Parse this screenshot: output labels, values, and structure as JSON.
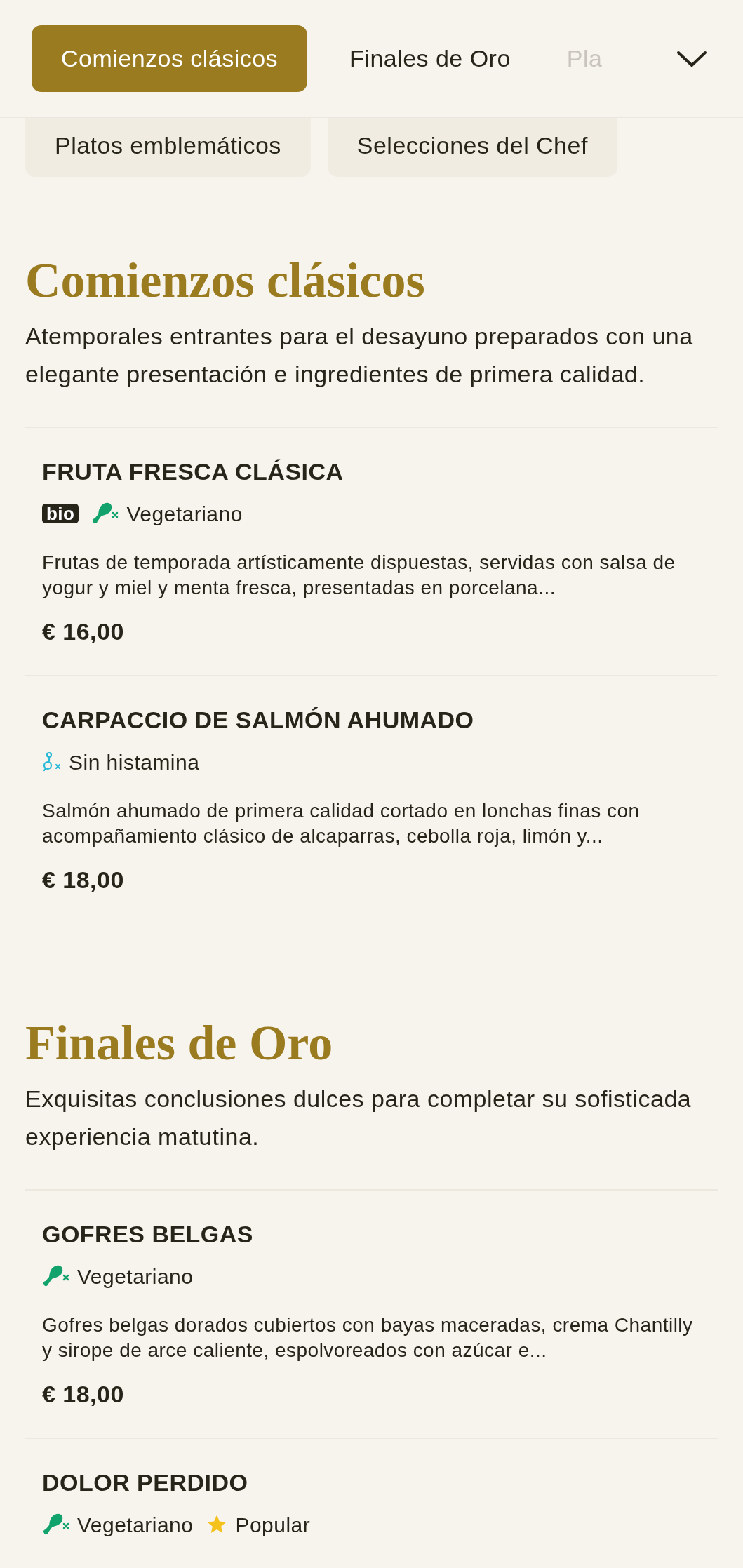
{
  "tabs": [
    {
      "label": "Comienzos clásicos",
      "selected": true
    },
    {
      "label": "Finales de Oro",
      "selected": false
    },
    {
      "label": "Pla",
      "selected": false,
      "cut": true
    }
  ],
  "category_chips": [
    "Platos emblemáticos",
    "Selecciones del Chef"
  ],
  "sections": [
    {
      "title": "Comienzos clásicos",
      "description": "Atemporales entrantes para el desayuno preparados con una elegante presentación e ingredientes de primera calidad.",
      "items": [
        {
          "name": "FRUTA FRESCA CLÁSICA",
          "tags": [
            {
              "kind": "bio",
              "label": "bio"
            },
            {
              "kind": "vegetarian",
              "label": "Vegetariano"
            }
          ],
          "description": "Frutas de temporada artísticamente dispuestas, servidas con salsa de yogur y miel y menta fresca, presentadas en porcelana...",
          "price": "€ 16,00"
        },
        {
          "name": "CARPACCIO DE SALMÓN AHUMADO",
          "tags": [
            {
              "kind": "histamine_free",
              "label": "Sin histamina"
            }
          ],
          "description": "Salmón ahumado de primera calidad cortado en lonchas finas con acompañamiento clásico de alcaparras, cebolla roja, limón y...",
          "price": "€ 18,00"
        }
      ]
    },
    {
      "title": "Finales de Oro",
      "description": "Exquisitas conclusiones dulces para completar su sofisticada experiencia matutina.",
      "items": [
        {
          "name": "GOFRES BELGAS",
          "tags": [
            {
              "kind": "vegetarian",
              "label": "Vegetariano"
            }
          ],
          "description": "Gofres belgas dorados cubiertos con bayas maceradas, crema Chantilly y sirope de arce caliente, espolvoreados con azúcar e...",
          "price": "€ 18,00"
        },
        {
          "name": "DOLOR PERDIDO",
          "tags": [
            {
              "kind": "vegetarian",
              "label": "Vegetariano"
            },
            {
              "kind": "popular",
              "label": "Popular"
            }
          ]
        }
      ]
    }
  ]
}
